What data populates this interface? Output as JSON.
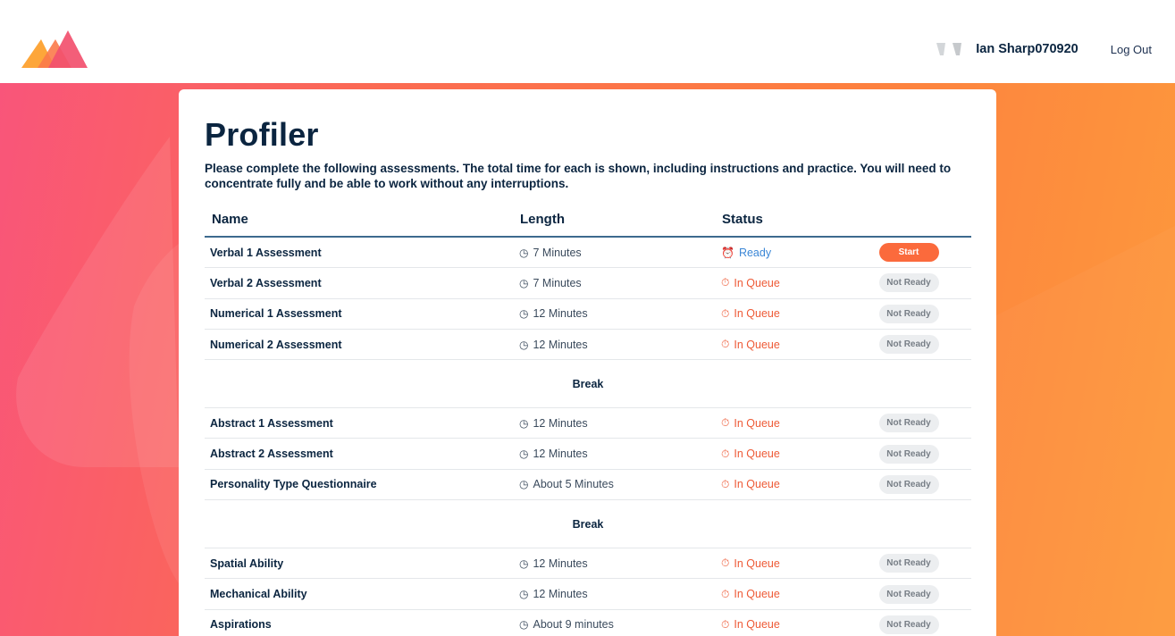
{
  "header": {
    "user_name": "Ian Sharp070920",
    "logout_label": "Log Out"
  },
  "page": {
    "title": "Profiler",
    "intro": "Please complete the following assessments. The total time for each is shown, including instructions and practice. You will need to concentrate fully and be able to work without any interruptions."
  },
  "table": {
    "headers": {
      "name": "Name",
      "length": "Length",
      "status": "Status"
    },
    "groups": [
      {
        "rows": [
          {
            "name": "Verbal 1 Assessment",
            "length": "7 Minutes",
            "status": "Ready",
            "status_type": "ready",
            "action": "Start"
          },
          {
            "name": "Verbal 2 Assessment",
            "length": "7 Minutes",
            "status": "In Queue",
            "status_type": "queue",
            "action": "Not Ready"
          },
          {
            "name": "Numerical 1 Assessment",
            "length": "12 Minutes",
            "status": "In Queue",
            "status_type": "queue",
            "action": "Not Ready"
          },
          {
            "name": "Numerical 2 Assessment",
            "length": "12 Minutes",
            "status": "In Queue",
            "status_type": "queue",
            "action": "Not Ready"
          }
        ]
      },
      {
        "break_label": "Break"
      },
      {
        "rows": [
          {
            "name": "Abstract 1 Assessment",
            "length": "12 Minutes",
            "status": "In Queue",
            "status_type": "queue",
            "action": "Not Ready"
          },
          {
            "name": "Abstract 2 Assessment",
            "length": "12 Minutes",
            "status": "In Queue",
            "status_type": "queue",
            "action": "Not Ready"
          },
          {
            "name": "Personality Type Questionnaire",
            "length": "About 5 Minutes",
            "status": "In Queue",
            "status_type": "queue",
            "action": "Not Ready"
          }
        ]
      },
      {
        "break_label": "Break"
      },
      {
        "rows": [
          {
            "name": "Spatial Ability",
            "length": "12 Minutes",
            "status": "In Queue",
            "status_type": "queue",
            "action": "Not Ready"
          },
          {
            "name": "Mechanical Ability",
            "length": "12 Minutes",
            "status": "In Queue",
            "status_type": "queue",
            "action": "Not Ready"
          },
          {
            "name": "Aspirations",
            "length": "About 9 minutes",
            "status": "In Queue",
            "status_type": "queue",
            "action": "Not Ready"
          }
        ]
      }
    ]
  },
  "icons": {
    "logo": "brand-logo-icon",
    "length": "clock-icon",
    "ready": "alarm-clock-icon",
    "queue": "stopwatch-icon"
  },
  "colors": {
    "primary_text": "#0b2540",
    "accent_orange": "#fb6a3c",
    "ready_blue": "#3a86d6",
    "queue_red": "#ee5a36",
    "gradient_start": "#f9557a",
    "gradient_end": "#fd9a3c"
  }
}
